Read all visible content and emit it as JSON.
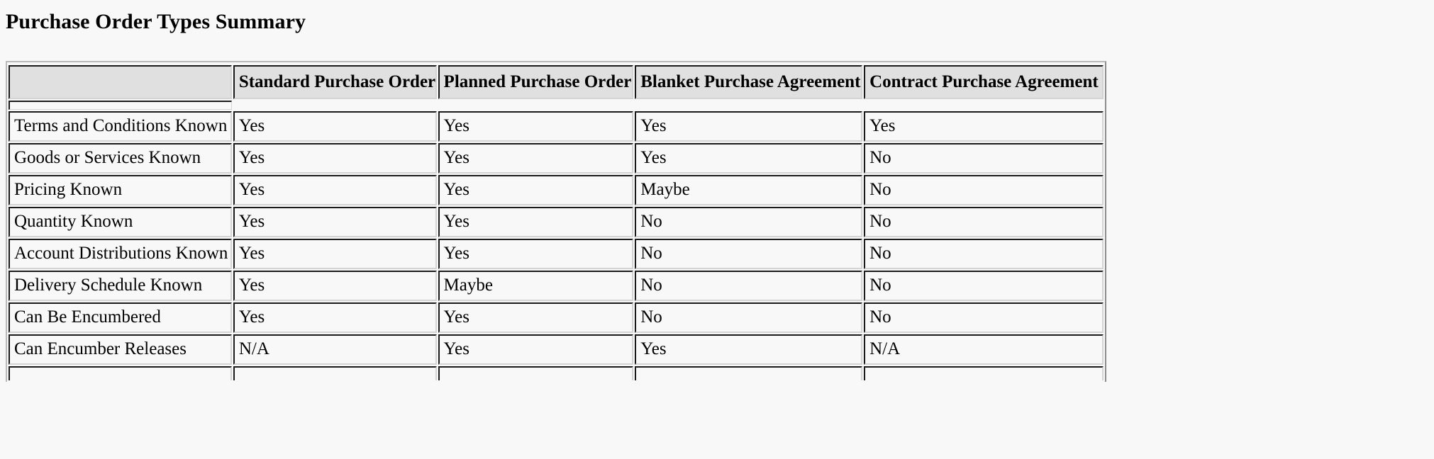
{
  "page": {
    "title": "Purchase Order Types Summary",
    "background_color": "#f8f8f8",
    "header_background_color": "#e0e0e0",
    "text_color": "#000000",
    "border_dark_color": "#1a1a1a",
    "border_light_color": "#d4d4d4"
  },
  "chart_data": {
    "type": "table",
    "title": "Purchase Order Types Summary",
    "columns": [
      "",
      "Standard Purchase Order",
      "Planned Purchase Order",
      "Blanket Purchase Agreement",
      "Contract Purchase Agreement"
    ],
    "rows": [
      {
        "label": "Terms and Conditions Known",
        "values": [
          "Yes",
          "Yes",
          "Yes",
          "Yes"
        ]
      },
      {
        "label": "Goods or Services Known",
        "values": [
          "Yes",
          "Yes",
          "Yes",
          "No"
        ]
      },
      {
        "label": "Pricing Known",
        "values": [
          "Yes",
          "Yes",
          "Maybe",
          "No"
        ]
      },
      {
        "label": "Quantity Known",
        "values": [
          "Yes",
          "Yes",
          "No",
          "No"
        ]
      },
      {
        "label": "Account Distributions Known",
        "values": [
          "Yes",
          "Yes",
          "No",
          "No"
        ]
      },
      {
        "label": "Delivery Schedule Known",
        "values": [
          "Yes",
          "Maybe",
          "No",
          "No"
        ]
      },
      {
        "label": "Can Be Encumbered",
        "values": [
          "Yes",
          "Yes",
          "No",
          "No"
        ]
      },
      {
        "label": "Can Encumber Releases",
        "values": [
          "N/A",
          "Yes",
          "Yes",
          "N/A"
        ]
      }
    ]
  },
  "table": {
    "headers": {
      "corner": "",
      "col1": "Standard Purchase Order",
      "col2": "Planned Purchase Order",
      "col3": "Blanket Purchase Agreement",
      "col4": "Contract Purchase Agreement"
    },
    "body": [
      {
        "label": "Terms and Conditions Known",
        "standard": "Yes",
        "planned": "Yes",
        "blanket": "Yes",
        "contract": "Yes"
      },
      {
        "label": "Goods or Services Known",
        "standard": "Yes",
        "planned": "Yes",
        "blanket": "Yes",
        "contract": "No"
      },
      {
        "label": "Pricing Known",
        "standard": "Yes",
        "planned": "Yes",
        "blanket": "Maybe",
        "contract": "No"
      },
      {
        "label": "Quantity Known",
        "standard": "Yes",
        "planned": "Yes",
        "blanket": "No",
        "contract": "No"
      },
      {
        "label": "Account Distributions Known",
        "standard": "Yes",
        "planned": "Yes",
        "blanket": "No",
        "contract": "No"
      },
      {
        "label": "Delivery Schedule Known",
        "standard": "Yes",
        "planned": "Maybe",
        "blanket": "No",
        "contract": "No"
      },
      {
        "label": "Can Be Encumbered",
        "standard": "Yes",
        "planned": "Yes",
        "blanket": "No",
        "contract": "No"
      },
      {
        "label": "Can Encumber Releases",
        "standard": "N/A",
        "planned": "Yes",
        "blanket": "Yes",
        "contract": "N/A"
      }
    ]
  }
}
